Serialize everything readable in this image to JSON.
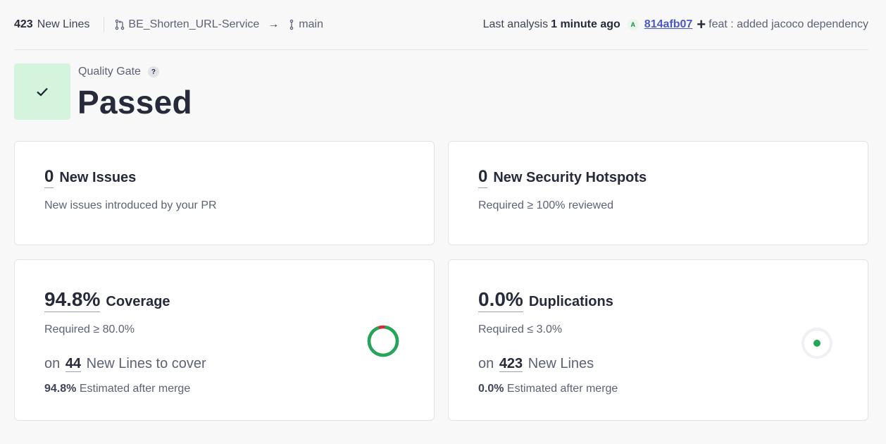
{
  "header": {
    "new_lines_count": "423",
    "new_lines_label": "New Lines",
    "source_branch": "BE_Shorten_URL-Service",
    "arrow": "→",
    "target_branch": "main",
    "last_analysis_label": "Last analysis",
    "last_analysis_time": "1 minute ago",
    "author_initial": "A",
    "commit_hash": "814afb07",
    "commit_message": "feat : added jacoco dependency"
  },
  "quality_gate": {
    "label": "Quality Gate",
    "help": "?",
    "status": "Passed"
  },
  "cards": {
    "issues": {
      "value": "0",
      "title": "New Issues",
      "subtitle": "New issues introduced by your PR"
    },
    "hotspots": {
      "value": "0",
      "title": "New Security Hotspots",
      "subtitle": "Required ≥ 100% reviewed"
    },
    "coverage": {
      "value": "94.8%",
      "title": "Coverage",
      "subtitle": "Required ≥ 80.0%",
      "lines_prefix": "on",
      "lines_count": "44",
      "lines_suffix": "New Lines to cover",
      "estimate_value": "94.8%",
      "estimate_label": "Estimated after merge",
      "percent": 94.8
    },
    "duplications": {
      "value": "0.0%",
      "title": "Duplications",
      "subtitle": "Required ≤ 3.0%",
      "lines_prefix": "on",
      "lines_count": "423",
      "lines_suffix": "New Lines",
      "estimate_value": "0.0%",
      "estimate_label": "Estimated after merge"
    }
  },
  "colors": {
    "pass_green": "#1fa85a",
    "fail_red": "#d02f3a",
    "gate_bg": "#d4f4de",
    "link_blue": "#4b58c8"
  }
}
